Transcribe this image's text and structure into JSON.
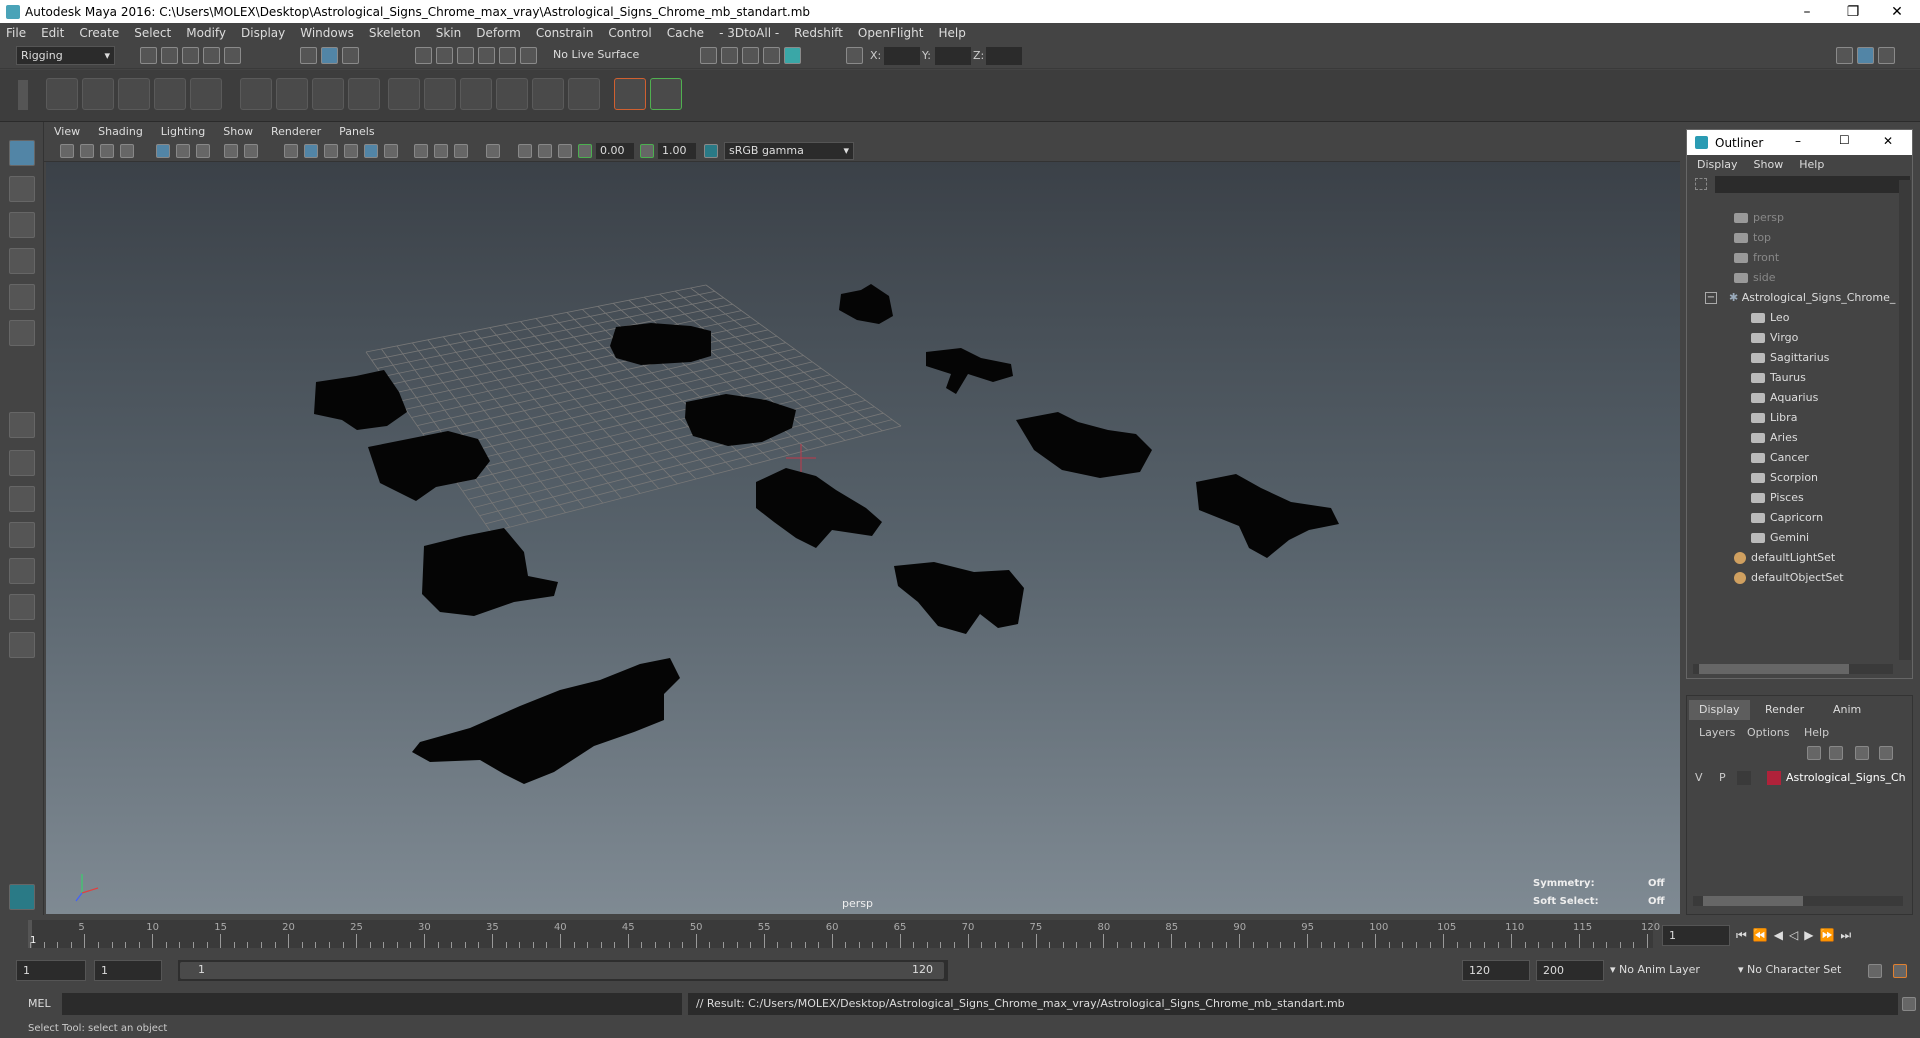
{
  "window": {
    "title": "Autodesk Maya 2016: C:\\Users\\MOLEX\\Desktop\\Astrological_Signs_Chrome_max_vray\\Astrological_Signs_Chrome_mb_standart.mb",
    "min": "–",
    "max": "❐",
    "close": "✕"
  },
  "menubar": [
    "File",
    "Edit",
    "Create",
    "Select",
    "Modify",
    "Display",
    "Windows",
    "Skeleton",
    "Skin",
    "Deform",
    "Constrain",
    "Control",
    "Cache",
    "- 3DtoAll -",
    "Redshift",
    "OpenFlight",
    "Help"
  ],
  "statusline": {
    "menuset": "Rigging",
    "live_surface": "No Live Surface",
    "x_label": "X:",
    "y_label": "Y:",
    "z_label": "Z:"
  },
  "panel": {
    "menus": [
      "View",
      "Shading",
      "Lighting",
      "Show",
      "Renderer",
      "Panels"
    ],
    "exposure": "0.00",
    "gamma": "1.00",
    "colorspace": "sRGB gamma"
  },
  "viewport": {
    "camera": "persp",
    "symmetry_label": "Symmetry:",
    "symmetry_value": "Off",
    "softselect_label": "Soft Select:",
    "softselect_value": "Off"
  },
  "outliner": {
    "title": "Outliner",
    "menus": [
      "Display",
      "Show",
      "Help"
    ],
    "cameras": [
      "persp",
      "top",
      "front",
      "side"
    ],
    "group": "Astrological_Signs_Chrome_",
    "children": [
      "Leo",
      "Virgo",
      "Sagittarius",
      "Taurus",
      "Aquarius",
      "Libra",
      "Aries",
      "Cancer",
      "Scorpion",
      "Pisces",
      "Capricorn",
      "Gemini"
    ],
    "sets": [
      "defaultLightSet",
      "defaultObjectSet"
    ]
  },
  "layers": {
    "tabs": [
      "Display",
      "Render",
      "Anim"
    ],
    "menus": [
      "Layers",
      "Options",
      "Help"
    ],
    "row": {
      "v": "V",
      "p": "P",
      "name": "Astrological_Signs_Ch",
      "color": "#b0223a"
    }
  },
  "timeline": {
    "ticks": [
      "5",
      "10",
      "15",
      "20",
      "25",
      "30",
      "35",
      "40",
      "45",
      "50",
      "55",
      "60",
      "65",
      "70",
      "75",
      "80",
      "85",
      "90",
      "95",
      "100",
      "105",
      "110",
      "115",
      "120"
    ],
    "current_frame_marker": "1",
    "current_frame": "1"
  },
  "range": {
    "start": "1",
    "anim_start": "1",
    "slider_start": "1",
    "slider_end": "120",
    "end": "120",
    "anim_end": "200",
    "anim_layer": "No Anim Layer",
    "char_set": "No Character Set"
  },
  "cmd": {
    "lang": "MEL",
    "result": "// Result: C:/Users/MOLEX/Desktop/Astrological_Signs_Chrome_max_vray/Astrological_Signs_Chrome_mb_standart.mb"
  },
  "help": "Select Tool: select an object"
}
